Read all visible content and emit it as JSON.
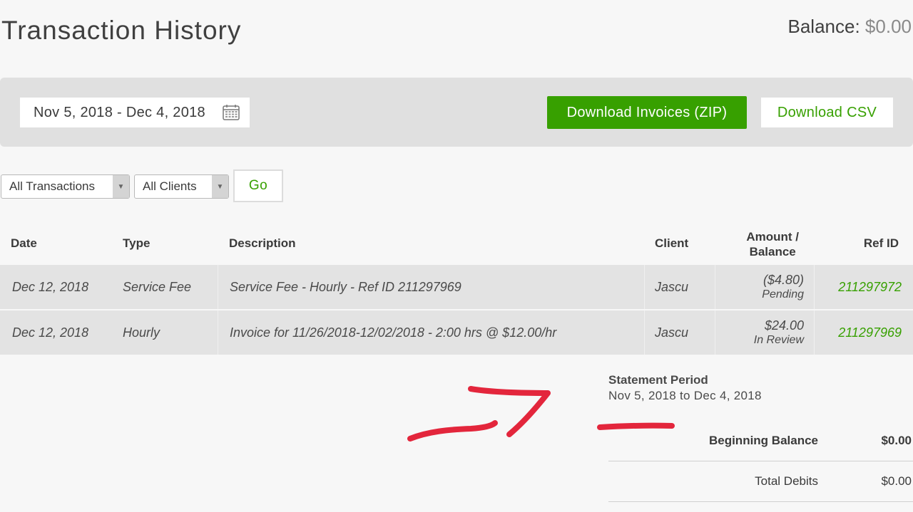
{
  "header": {
    "title": "Transaction History",
    "balance_label": "Balance:",
    "balance_value": "$0.00"
  },
  "toolbar": {
    "date_range": "Nov 5, 2018 - Dec 4, 2018",
    "calendar_icon": "calendar-icon",
    "download_zip_label": "Download Invoices (ZIP)",
    "download_csv_label": "Download CSV"
  },
  "filters": {
    "transactions_selected": "All Transactions",
    "clients_selected": "All Clients",
    "go_label": "Go"
  },
  "table": {
    "headers": {
      "date": "Date",
      "type": "Type",
      "description": "Description",
      "client": "Client",
      "amount_line1": "Amount /",
      "amount_line2": "Balance",
      "ref": "Ref ID"
    },
    "rows": [
      {
        "date": "Dec 12, 2018",
        "type": "Service Fee",
        "description": "Service Fee - Hourly - Ref ID 211297969",
        "client": "Jascu",
        "amount": "($4.80)",
        "status": "Pending",
        "ref": "211297972"
      },
      {
        "date": "Dec 12, 2018",
        "type": "Hourly",
        "description": "Invoice for 11/26/2018-12/02/2018 - 2:00 hrs @ $12.00/hr",
        "client": "Jascu",
        "amount": "$24.00",
        "status": "In Review",
        "ref": "211297969"
      }
    ]
  },
  "statement": {
    "title": "Statement Period",
    "range": "Nov 5, 2018 to Dec 4, 2018",
    "beginning_label": "Beginning Balance",
    "beginning_value": "$0.00",
    "debits_label": "Total Debits",
    "debits_value": "$0.00"
  },
  "colors": {
    "accent_green": "#37a000",
    "annotation_red": "#e3263c"
  }
}
